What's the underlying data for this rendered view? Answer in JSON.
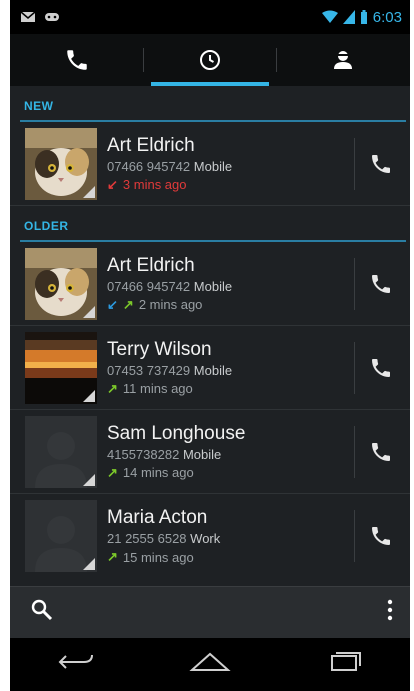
{
  "status_bar": {
    "time": "6:03"
  },
  "tabs": [
    {
      "name": "phone",
      "icon": "phone-icon"
    },
    {
      "name": "call-log",
      "icon": "clock-icon",
      "active": true
    },
    {
      "name": "contacts",
      "icon": "person-icon"
    }
  ],
  "sections": {
    "new": {
      "label": "NEW"
    },
    "older": {
      "label": "OLDER"
    }
  },
  "calls": [
    {
      "name": "Art Eldrich",
      "number": "07466 945742",
      "type": "Mobile",
      "when": "3 mins ago",
      "kind": "missed",
      "avatar": "cat"
    },
    {
      "name": "Art Eldrich",
      "number": "07466 945742",
      "type": "Mobile",
      "when": "2 mins ago",
      "kind": "in-out",
      "avatar": "cat"
    },
    {
      "name": "Terry Wilson",
      "number": "07453 737429",
      "type": "Mobile",
      "when": "11 mins ago",
      "kind": "out",
      "avatar": "sunset"
    },
    {
      "name": "Sam Longhouse",
      "number": "4155738282",
      "type": "Mobile",
      "when": "14 mins ago",
      "kind": "out",
      "avatar": "placeholder"
    },
    {
      "name": "Maria Acton",
      "number": "21 2555 6528",
      "type": "Work",
      "when": "15 mins ago",
      "kind": "out",
      "avatar": "placeholder"
    }
  ],
  "colors": {
    "accent": "#34b5e5",
    "missed": "#e03a3a",
    "outgoing": "#7cc82a",
    "incoming": "#2c9be0"
  }
}
